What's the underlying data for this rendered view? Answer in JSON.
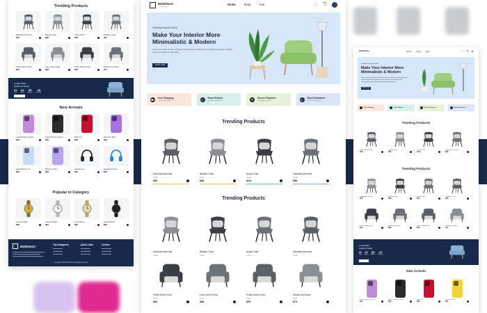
{
  "colors": {
    "navy": "#172a4a",
    "hero_bg": "#d6e6fb",
    "feature_bgs": [
      "#fde7dc",
      "#d7f0e9",
      "#e6f2d7",
      "#dbe7f9"
    ],
    "progress_bars": [
      "#f0c542",
      "#f0c542",
      "#5fc08f",
      "#7fa8e6"
    ]
  },
  "left": {
    "trending_title": "Trending Products",
    "trending": [
      {
        "name": "Sakarias Armchair",
        "price": "$59"
      },
      {
        "name": "Baltsar Chair",
        "price": "$88"
      },
      {
        "name": "Anjay Chair",
        "price": "$59"
      },
      {
        "name": "Nyantuy Chair",
        "price": "$49"
      },
      {
        "name": "Fluffy Sheep Sofa",
        "price": "$91"
      },
      {
        "name": "Faux Velvet Sofa",
        "price": "$88"
      },
      {
        "name": "Fluffy Sheep Sofa",
        "price": "$99"
      },
      {
        "name": "Modern Armchair",
        "price": "$71"
      }
    ],
    "banner": {
      "line1": "Limited Offer",
      "line2": "Quality Armchair",
      "countdown": [
        {
          "value": "01",
          "unit": "Days"
        },
        {
          "value": "24",
          "unit": "Hours"
        },
        {
          "value": "55",
          "unit": "Minutes"
        },
        {
          "value": "15",
          "unit": "Seconds"
        }
      ]
    },
    "new_title": "New Arrivals",
    "new_arrivals": [
      {
        "name": "Apple iPhone 11 Pro",
        "price": "$99",
        "color": "#c08ad9"
      },
      {
        "name": "Apple iPhone 11 Pro",
        "price": "$99",
        "color": "#2b2b2b"
      },
      {
        "name": "Redmi 8",
        "price": "$99",
        "color": "#c8102e"
      },
      {
        "name": "Ultra Pro Max",
        "price": "$99",
        "color": "#a970e0"
      },
      {
        "name": "Apple iPhone 12",
        "price": "$99",
        "color": "#c9dcf5"
      },
      {
        "name": "iPhone 12 Pro",
        "price": "$99",
        "color": "#b8a2f0"
      },
      {
        "name": "Headphone",
        "price": "$99",
        "color": "#222222"
      },
      {
        "name": "Headphone Pro",
        "price": "$99",
        "color": "#2b86d9"
      }
    ],
    "popular_title": "Popular in Category",
    "popular": [
      {
        "name": "Luxury Watch",
        "price": "$99"
      },
      {
        "name": "Classic Watch",
        "price": "$99"
      },
      {
        "name": "Gold Watch",
        "price": "$99"
      },
      {
        "name": "Apple Watch",
        "price": "$99"
      }
    ],
    "footer": {
      "brand": "MultiHeart",
      "col1": "Top Categories",
      "col2": "Quick Links",
      "col3": "Contact",
      "copyright": "Copyright ©2022 MultiHeart All Rights Reserved"
    }
  },
  "mid": {
    "logo": "MultiHeart",
    "logo_sub": "Furniture Store",
    "nav": [
      "Home",
      "Shop",
      "Cart"
    ],
    "hero": {
      "sub": "Trending Product in 2023",
      "title_line1": "Make Your Interior More",
      "title_line2": "Minimalistic & Modern",
      "desc": "Lorem ipsum dolor sit amet consectetur adipisicing elit. Ullamco ex et voluptate, molestiae molestias ratione exercitationem quis dolor.",
      "button": "SHOP NOW"
    },
    "features": [
      {
        "title": "Free Shipping",
        "sub": "Lorem ipsum dolor sit"
      },
      {
        "title": "Easy Returns",
        "sub": "Lorem ipsum dolor sit"
      },
      {
        "title": "Secure Payment",
        "sub": "Lorem ipsum dolor sit"
      },
      {
        "title": "Back Guarantee",
        "sub": "Lorem ipsum dolor sit"
      }
    ],
    "section1_title": "Trending Products",
    "section2_title": "Trending Products",
    "row1": [
      {
        "name": "Sakarias Armchair",
        "cat": "Chair",
        "price": "$59"
      },
      {
        "name": "Baltsar Chair",
        "cat": "Chair",
        "price": "$88"
      },
      {
        "name": "Anjay Chair",
        "cat": "Chair",
        "price": "$112"
      },
      {
        "name": "Sakarias Armchair",
        "cat": "Chair",
        "price": "$88"
      }
    ],
    "row2": [
      {
        "name": "Sakarias Armchair",
        "cat": "Chair",
        "price": "$59"
      },
      {
        "name": "Baltsar Chair",
        "cat": "Chair",
        "price": "$88"
      },
      {
        "name": "Anjay Chair",
        "cat": "Chair",
        "price": "$59"
      },
      {
        "name": "Sakarias Armchair",
        "cat": "Chair",
        "price": "$49"
      }
    ],
    "row3": [
      {
        "name": "Fluffy Sheep Sofa",
        "cat": "Sofa",
        "price": "$63"
      },
      {
        "name": "Faux Velvet Sofa",
        "cat": "Sofa",
        "price": "$88"
      },
      {
        "name": "Fluffy Sheep Sofa",
        "cat": "Sofa",
        "price": "$59"
      },
      {
        "name": "Modern Armchair",
        "cat": "Sofa",
        "price": "$73"
      }
    ]
  },
  "right": {
    "logo": "MultiHeart",
    "nav": [
      "Home",
      "Shop",
      "Cart"
    ],
    "hero": {
      "sub": "Trending Product in 2023",
      "title_line1": "Make Your Interior More",
      "title_line2": "Minimalistic & Modern",
      "button": "SHOP NOW"
    },
    "features": [
      "Free Shipping",
      "Easy Returns",
      "Secure Payment",
      "Back Guarantee"
    ],
    "section1_title": "Trending Products",
    "section2_title": "Trending Products",
    "row1": [
      {
        "name": "Sakarias Armchair",
        "price": "$59"
      },
      {
        "name": "Baltsar Chair",
        "price": "$88"
      },
      {
        "name": "Anjay Chair",
        "price": "$112"
      },
      {
        "name": "Sakarias Armchair",
        "price": "$88"
      }
    ],
    "row2": [
      {
        "name": "Sakarias Armchair",
        "price": "$59"
      },
      {
        "name": "Baltsar Chair",
        "price": "$88"
      },
      {
        "name": "Anjay Chair",
        "price": "$59"
      },
      {
        "name": "Nyantuy Chair",
        "price": "$49"
      }
    ],
    "row3": [
      {
        "name": "Fluffy Sheep Sofa",
        "price": "$63"
      },
      {
        "name": "Faux Velvet Sofa",
        "price": "$88"
      },
      {
        "name": "Fluffy Sheep Sofa",
        "price": "$59"
      },
      {
        "name": "Modern Armchair",
        "price": "$73"
      }
    ],
    "banner": {
      "line1": "Limited Offer",
      "line2": "Quality Armchair",
      "countdown": [
        {
          "value": "01",
          "unit": "Days"
        },
        {
          "value": "24",
          "unit": "Hours"
        },
        {
          "value": "55",
          "unit": "Minutes"
        },
        {
          "value": "15",
          "unit": "Seconds"
        }
      ]
    },
    "new_title": "New Arrivals",
    "new_arrivals": [
      {
        "name": "Apple iPhone 11 Pro",
        "price": "$99",
        "color": "#c08ad9"
      },
      {
        "name": "Apple iPhone 11 Pro",
        "price": "$99",
        "color": "#2b2b2b"
      },
      {
        "name": "Redmi 8",
        "price": "$99",
        "color": "#c8102e"
      },
      {
        "name": "Ultra Pro Max",
        "price": "$99",
        "color": "#f1d23a"
      }
    ]
  }
}
